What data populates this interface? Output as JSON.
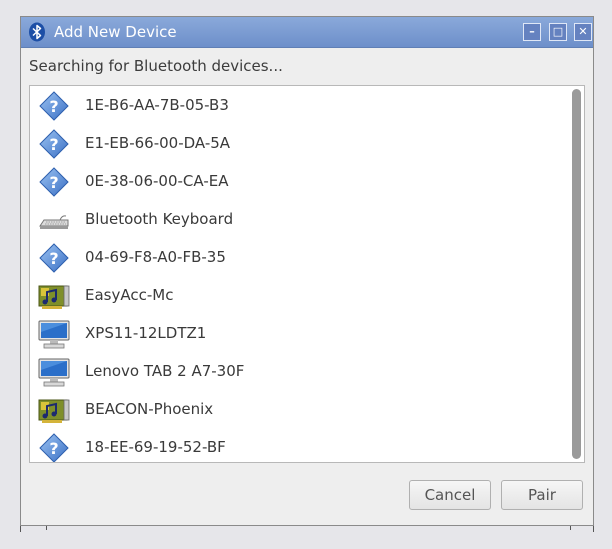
{
  "window": {
    "title": "Add New Device",
    "minimize_icon": "minimize-icon",
    "maximize_icon": "maximize-icon",
    "close_icon": "close-icon"
  },
  "status": "Searching for Bluetooth devices...",
  "devices": [
    {
      "label": "1E-B6-AA-7B-05-B3",
      "icon": "unknown-device-icon"
    },
    {
      "label": "E1-EB-66-00-DA-5A",
      "icon": "unknown-device-icon"
    },
    {
      "label": "0E-38-06-00-CA-EA",
      "icon": "unknown-device-icon"
    },
    {
      "label": "Bluetooth Keyboard",
      "icon": "keyboard-icon"
    },
    {
      "label": "04-69-F8-A0-FB-35",
      "icon": "unknown-device-icon"
    },
    {
      "label": "EasyAcc-Mc",
      "icon": "audio-card-icon"
    },
    {
      "label": "XPS11-12LDTZ1",
      "icon": "computer-icon"
    },
    {
      "label": "Lenovo TAB 2 A7-30F",
      "icon": "computer-icon"
    },
    {
      "label": "BEACON-Phoenix",
      "icon": "audio-card-icon"
    },
    {
      "label": "18-EE-69-19-52-BF",
      "icon": "unknown-device-icon"
    }
  ],
  "buttons": {
    "cancel": "Cancel",
    "pair": "Pair"
  },
  "colors": {
    "titlebar": "#7a99d2",
    "unknown_icon": "#4a7cc9"
  }
}
